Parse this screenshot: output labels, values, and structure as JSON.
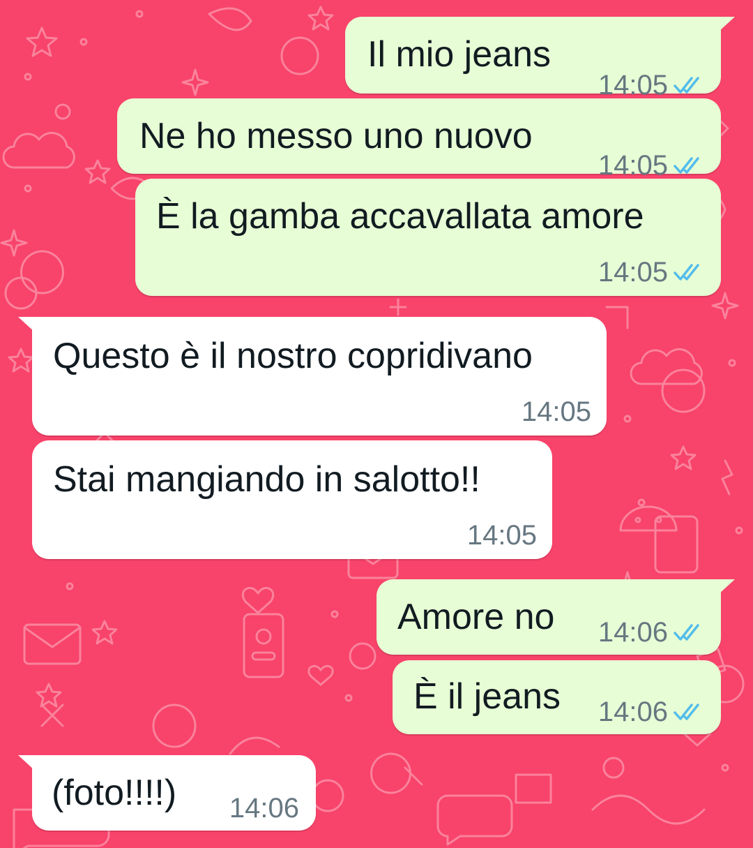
{
  "colors": {
    "wallpaper": "#f8436a",
    "wallpaper_doodle": "#fb8aa2",
    "outgoing_bubble": "#e7fdd5",
    "incoming_bubble": "#ffffff",
    "text": "#111b21",
    "timestamp": "#667781",
    "read_ticks": "#53bdeb"
  },
  "messages": [
    {
      "direction": "outgoing",
      "text": "Il mio jeans",
      "time": "14:05",
      "status_icon": "double-check-read-icon"
    },
    {
      "direction": "outgoing",
      "text": "Ne ho messo uno nuovo",
      "time": "14:05",
      "status_icon": "double-check-read-icon"
    },
    {
      "direction": "outgoing",
      "text": "È la gamba accavallata amore",
      "time": "14:05",
      "status_icon": "double-check-read-icon"
    },
    {
      "direction": "incoming",
      "text": "Questo è il nostro copridivano",
      "time": "14:05"
    },
    {
      "direction": "incoming",
      "text": "Stai mangiando in salotto!!",
      "time": "14:05"
    },
    {
      "direction": "outgoing",
      "text": "Amore no",
      "time": "14:06",
      "status_icon": "double-check-read-icon"
    },
    {
      "direction": "outgoing",
      "text": "È il jeans",
      "time": "14:06",
      "status_icon": "double-check-read-icon"
    },
    {
      "direction": "incoming",
      "text": "(foto!!!!)",
      "time": "14:06"
    }
  ]
}
